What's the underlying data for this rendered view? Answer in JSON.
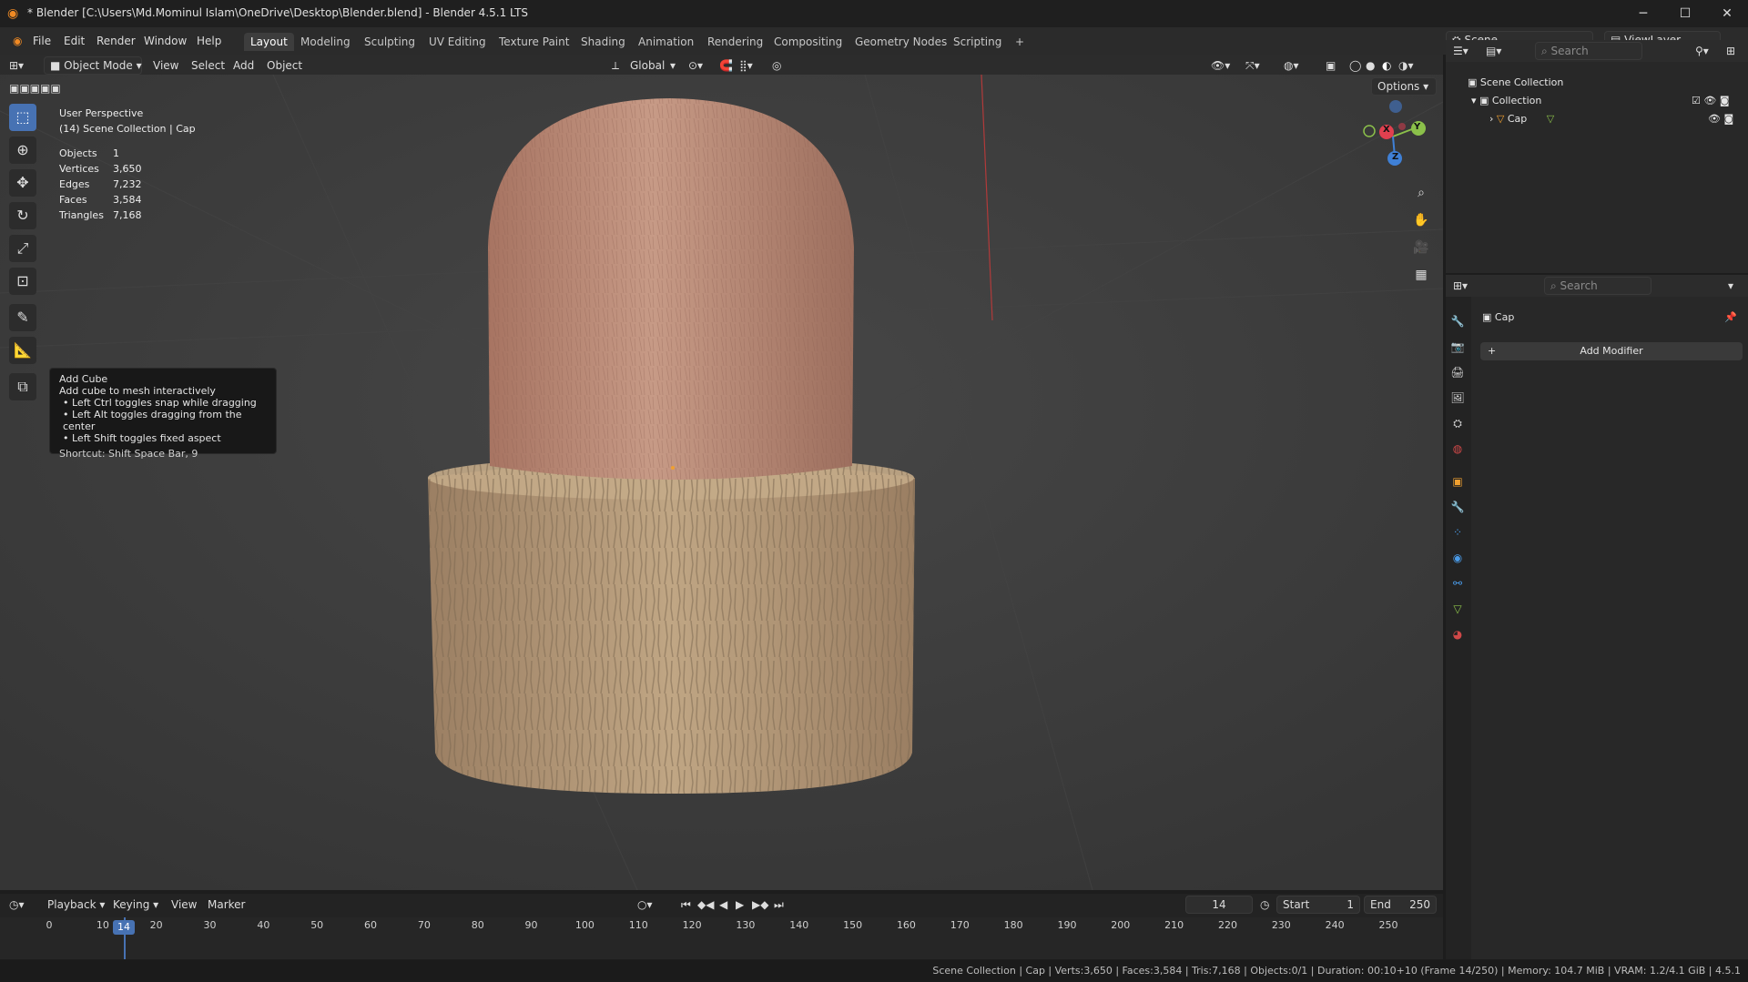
{
  "window": {
    "title": "* Blender [C:\\Users\\Md.Mominul Islam\\OneDrive\\Desktop\\Blender.blend] - Blender 4.5.1 LTS",
    "minimize": "─",
    "maximize": "☐",
    "close": "✕"
  },
  "menu": {
    "file": "File",
    "edit": "Edit",
    "render": "Render",
    "window": "Window",
    "help": "Help"
  },
  "workspaces": [
    "Layout",
    "Modeling",
    "Sculpting",
    "UV Editing",
    "Texture Paint",
    "Shading",
    "Animation",
    "Rendering",
    "Compositing",
    "Geometry Nodes",
    "Scripting"
  ],
  "add_workspace": "+",
  "scene": {
    "label": "Scene",
    "view_layer": "ViewLayer"
  },
  "viewport_header": {
    "mode": "Object Mode",
    "view": "View",
    "select": "Select",
    "add": "Add",
    "object": "Object",
    "orientation": "Global",
    "options": "Options"
  },
  "overlay": {
    "perspective": "User Perspective",
    "context": "(14) Scene Collection | Cap"
  },
  "stats": [
    {
      "label": "Objects",
      "value": "1"
    },
    {
      "label": "Vertices",
      "value": "3,650"
    },
    {
      "label": "Edges",
      "value": "7,232"
    },
    {
      "label": "Faces",
      "value": "3,584"
    },
    {
      "label": "Triangles",
      "value": "7,168"
    }
  ],
  "tooltip": {
    "title": "Add Cube",
    "desc": "Add cube to mesh interactively",
    "line1": "• Left Ctrl toggles snap while dragging",
    "line2": "• Left Alt toggles dragging from the center",
    "line3": "• Left Shift toggles fixed aspect",
    "shortcut": "Shortcut: Shift Space Bar, 9"
  },
  "gizmo": {
    "x": "X",
    "y": "Y",
    "z": "Z"
  },
  "timeline": {
    "playback": "Playback",
    "keying": "Keying",
    "view": "View",
    "marker": "Marker",
    "current_frame": "14",
    "start_label": "Start",
    "start": "1",
    "end_label": "End",
    "end": "250",
    "ticks": [
      "0",
      "10",
      "20",
      "30",
      "40",
      "50",
      "60",
      "70",
      "80",
      "90",
      "100",
      "110",
      "120",
      "130",
      "140",
      "150",
      "160",
      "170",
      "180",
      "190",
      "200",
      "210",
      "220",
      "230",
      "240",
      "250"
    ],
    "playhead": "14"
  },
  "outliner": {
    "search_placeholder": "Search",
    "scene_collection": "Scene Collection",
    "collection": "Collection",
    "object": "Cap"
  },
  "properties": {
    "search_placeholder": "Search",
    "object_name": "Cap",
    "add_modifier": "Add Modifier"
  },
  "statusbar": {
    "text": "Scene Collection | Cap | Verts:3,650 | Faces:3,584 | Tris:7,168 | Objects:0/1 | Duration: 00:10+10 (Frame 14/250) | Memory: 104.7 MiB | VRAM: 1.2/4.1 GiB | 4.5.1"
  },
  "colors": {
    "accent": "#4772b3",
    "cap_top": "#b98672",
    "cap_base": "#b59a78",
    "axis_x": "#e0404f",
    "axis_y": "#8bc04a",
    "axis_z": "#3f80d6"
  }
}
